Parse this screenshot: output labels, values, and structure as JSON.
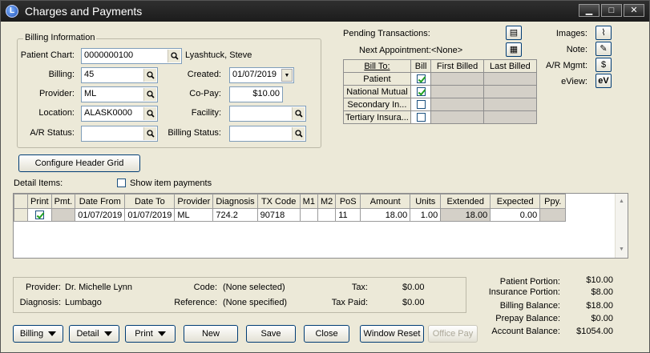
{
  "window": {
    "title": "Charges and Payments",
    "icon_letter": "L",
    "minimize": "▁",
    "maximize": "□",
    "close": "✕"
  },
  "billing_info": {
    "group_title": "Billing Information",
    "patient_chart_label": "Patient Chart:",
    "patient_chart_value": "0000000100",
    "patient_name": "Lyashtuck, Steve",
    "billing_label": "Billing:",
    "billing_value": "45",
    "created_label": "Created:",
    "created_value": "01/07/2019",
    "provider_label": "Provider:",
    "provider_value": "ML",
    "copay_label": "Co-Pay:",
    "copay_value": "$10.00",
    "location_label": "Location:",
    "location_value": "ALASK0000",
    "facility_label": "Facility:",
    "facility_value": "",
    "ar_status_label": "A/R Status:",
    "ar_status_value": "",
    "billing_status_label": "Billing Status:",
    "billing_status_value": ""
  },
  "pending": {
    "pending_label": "Pending Transactions:",
    "next_appt_label": "Next Appointment:",
    "next_appt_value": "<None>"
  },
  "bill_to": {
    "headers": [
      "Bill To:",
      "Bill",
      "First Billed",
      "Last Billed"
    ],
    "rows": [
      {
        "name": "Patient",
        "checked": true
      },
      {
        "name": "National Mutual",
        "checked": true
      },
      {
        "name": "Secondary In...",
        "checked": false
      },
      {
        "name": "Tertiary Insura...",
        "checked": false
      }
    ]
  },
  "side_links": {
    "images": "Images:",
    "note": "Note:",
    "ar_mgmt": "A/R Mgmt:",
    "eview": "eView:"
  },
  "configure_button": "Configure Header Grid",
  "detail_items_label": "Detail Items:",
  "show_item_payments_label": "Show item payments",
  "detail_grid": {
    "headers": [
      "Print",
      "Pmt.",
      "Date From",
      "Date To",
      "Provider",
      "Diagnosis",
      "TX Code",
      "M1",
      "M2",
      "PoS",
      "Amount",
      "Units",
      "Extended",
      "Expected",
      "Ppy."
    ],
    "rows": [
      {
        "print": true,
        "pmt": "",
        "date_from": "01/07/2019",
        "date_to": "01/07/2019",
        "provider": "ML",
        "diagnosis": "724.2",
        "tx_code": "90718",
        "m1": "",
        "m2": "",
        "pos": "11",
        "amount": "18.00",
        "units": "1.00",
        "extended": "18.00",
        "expected": "0.00",
        "ppy": ""
      }
    ]
  },
  "details": {
    "provider_label": "Provider:",
    "provider_value": "Dr. Michelle Lynn",
    "diagnosis_label": "Diagnosis:",
    "diagnosis_value": "Lumbago",
    "code_label": "Code:",
    "code_value": "(None selected)",
    "reference_label": "Reference:",
    "reference_value": "(None specified)",
    "tax_label": "Tax:",
    "tax_value": "$0.00",
    "tax_paid_label": "Tax Paid:",
    "tax_paid_value": "$0.00"
  },
  "summary": {
    "patient_portion_label": "Patient Portion:",
    "patient_portion_value": "$10.00",
    "insurance_portion_label": "Insurance Portion:",
    "insurance_portion_value": "$8.00",
    "billing_balance_label": "Billing Balance:",
    "billing_balance_value": "$18.00",
    "prepay_balance_label": "Prepay Balance:",
    "prepay_balance_value": "$0.00",
    "account_balance_label": "Account Balance:",
    "account_balance_value": "$1054.00"
  },
  "footer": {
    "billing": "Billing",
    "detail": "Detail",
    "print": "Print",
    "new": "New",
    "save": "Save",
    "close": "Close",
    "window_reset": "Window Reset",
    "office_pay": "Office Pay"
  }
}
